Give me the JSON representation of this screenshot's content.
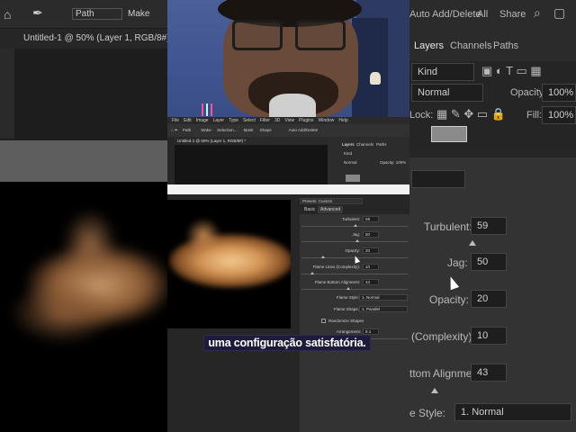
{
  "background_left": {
    "path_label": "Path",
    "make_label": "Make",
    "doc_tab": "Untitled-1 @ 50% (Layer 1, RGB/8#)"
  },
  "background_right": {
    "auto_add_delete": "Auto Add/Delete",
    "all_label": "All",
    "share_label": "Share",
    "tabs": [
      "Layers",
      "Channels",
      "Paths"
    ],
    "kind_label": "Kind",
    "blend_mode": "Normal",
    "opacity_label": "Opacity:",
    "opacity_value": "100%",
    "lock_label": "Lock:",
    "fill_label": "Fill:",
    "fill_value": "100%",
    "turbulent_label": "Turbulent:",
    "turbulent_value": "59",
    "jag_label": "Jag:",
    "jag_value": "50",
    "opacity2_label": "Opacity:",
    "opacity2_value": "20",
    "complexity_label": "(Complexity):",
    "complexity_value": "10",
    "bottom_alignment_label": "ttom Alignment:",
    "bottom_alignment_value": "43",
    "style_label": "e Style:",
    "style_value": "1. Normal"
  },
  "ps_window": {
    "menu": [
      "File",
      "Edit",
      "Image",
      "Layer",
      "Type",
      "Select",
      "Filter",
      "3D",
      "View",
      "Plugins",
      "Window",
      "Help"
    ],
    "options_path": "Path",
    "options_make": "Make:",
    "options_selection": "Selection...",
    "options_mask": "Mask",
    "options_shape": "Shape",
    "options_auto": "Auto Add/Delete",
    "doc_tab": "Untitled-1 @ 50% (Layer 1, RGB/8#) *",
    "layers_tabs": [
      "Layers",
      "Channels",
      "Paths"
    ],
    "kind": "Kind",
    "blend": "Normal",
    "opacity": "Opacity: 100%"
  },
  "dialog": {
    "preset_label": "Presets: Custom",
    "tabs": [
      "Basic",
      "Advanced"
    ],
    "fields": [
      {
        "label": "Turbulent:",
        "value": "59"
      },
      {
        "label": "Jag:",
        "value": "50"
      },
      {
        "label": "Opacity:",
        "value": "20"
      },
      {
        "label": "Flame Lines (Complexity):",
        "value": "10"
      },
      {
        "label": "Flame Bottom Alignment:",
        "value": "43"
      }
    ],
    "flame_style_label": "Flame Style:",
    "flame_style_value": "1. Normal",
    "flame_shape_label": "Flame Shape:",
    "flame_shape_value": "1. Parallel",
    "randomize_label": "Randomize Shapes",
    "arrangement_label": "Arrangement:",
    "arrangement_value": "8.1"
  },
  "caption": "uma configuração satisfatória."
}
